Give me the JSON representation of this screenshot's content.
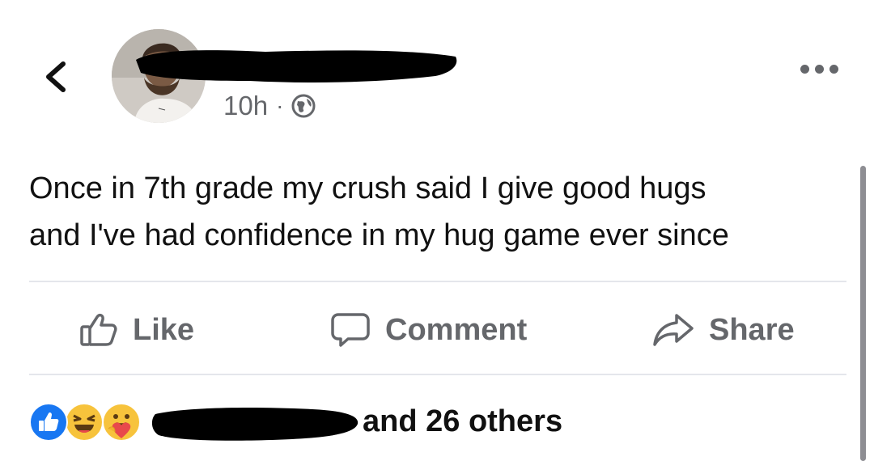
{
  "header": {
    "back_icon": "chevron-left-icon",
    "time": "10h",
    "separator": "·",
    "privacy_icon": "globe-icon",
    "more_icon": "more-horizontal-icon"
  },
  "post": {
    "text": "Once in 7th grade my crush said I give good hugs\nand I've had confidence in my hug game ever since"
  },
  "actions": {
    "like_label": "Like",
    "comment_label": "Comment",
    "share_label": "Share"
  },
  "reactions": {
    "icons": [
      "like-reaction-icon",
      "haha-reaction-icon",
      "care-reaction-icon"
    ],
    "summary": "and 26 others"
  },
  "colors": {
    "text": "#050505",
    "secondary": "#65676b",
    "divider": "#e4e6eb",
    "like_blue": "#1877f2",
    "reaction_yellow": "#f7c33c"
  }
}
